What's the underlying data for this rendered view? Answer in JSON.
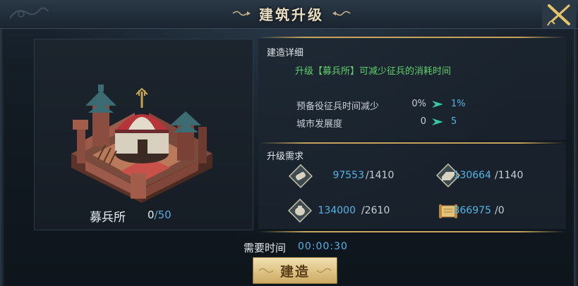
{
  "window": {
    "title": "建筑升级"
  },
  "building": {
    "name": "募兵所",
    "level_current": "0",
    "level_max": "/50"
  },
  "details": {
    "section_title": "建造详细",
    "description": "升级【募兵所】可减少征兵的消耗时间",
    "stats": [
      {
        "label": "预备役征兵时间减少",
        "current": "0%",
        "next": "1%"
      },
      {
        "label": "城市发展度",
        "current": "0",
        "next": "5"
      }
    ]
  },
  "requirements": {
    "section_title": "升级需求",
    "items": [
      {
        "icon": "wood-scroll-icon",
        "have": "97553",
        "need": "/1410"
      },
      {
        "icon": "iron-ingot-icon",
        "have": "130664",
        "need": "/1140"
      },
      {
        "icon": "grain-sack-icon",
        "have": "134000",
        "need": "/2610"
      },
      {
        "icon": "parchment-scroll-icon",
        "have": "866975",
        "need": "/0"
      }
    ]
  },
  "footer": {
    "time_label": "需要时间",
    "time_value": "00:00:30",
    "build_label": "建造"
  },
  "colors": {
    "accent_blue": "#56b3e4",
    "accent_green": "#5ed06b",
    "gold": "#c6a35c"
  }
}
